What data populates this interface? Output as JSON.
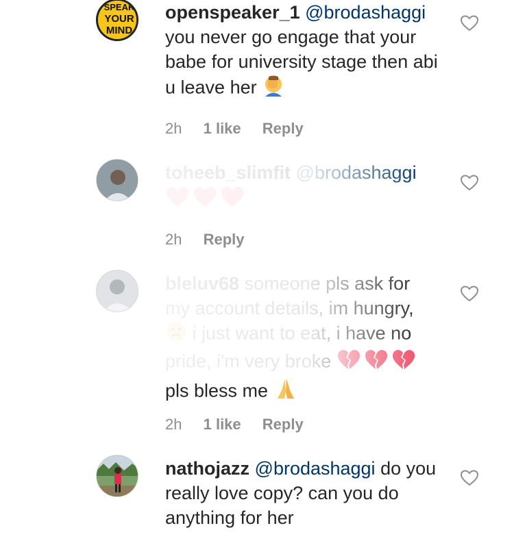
{
  "comments": [
    {
      "username": "openspeaker_1",
      "mention": "@brodashaggi",
      "text": "you never go engage that your babe for university stage then abi u leave her",
      "emoji": "face-palm",
      "time": "2h",
      "likes": "1 like",
      "reply": "Reply",
      "avatar_text": [
        "SPEAK",
        "YOUR",
        "MIND"
      ]
    },
    {
      "username": "toheeb_slimfit",
      "mention": "@brodashaggi",
      "text": "",
      "emoji": "hearts",
      "time": "2h",
      "reply": "Reply"
    },
    {
      "username": "bleluv68",
      "text_line1": "someone pls ask for",
      "text_line2": "my account details, im hungry,",
      "text_line3": "i just want to eat, i have no",
      "text_line4": "pride, i'm very broke",
      "text_line5": "pls bless me",
      "time": "2h",
      "likes": "1 like",
      "reply": "Reply"
    },
    {
      "username": "nathojazz",
      "mention": "@brodashaggi",
      "text": "do you really love copy? can you do anything for her"
    }
  ],
  "colors": {
    "text": "#262626",
    "mention": "#003569",
    "meta": "#8e8e8e",
    "avatar_yellow": "#f5c518"
  }
}
